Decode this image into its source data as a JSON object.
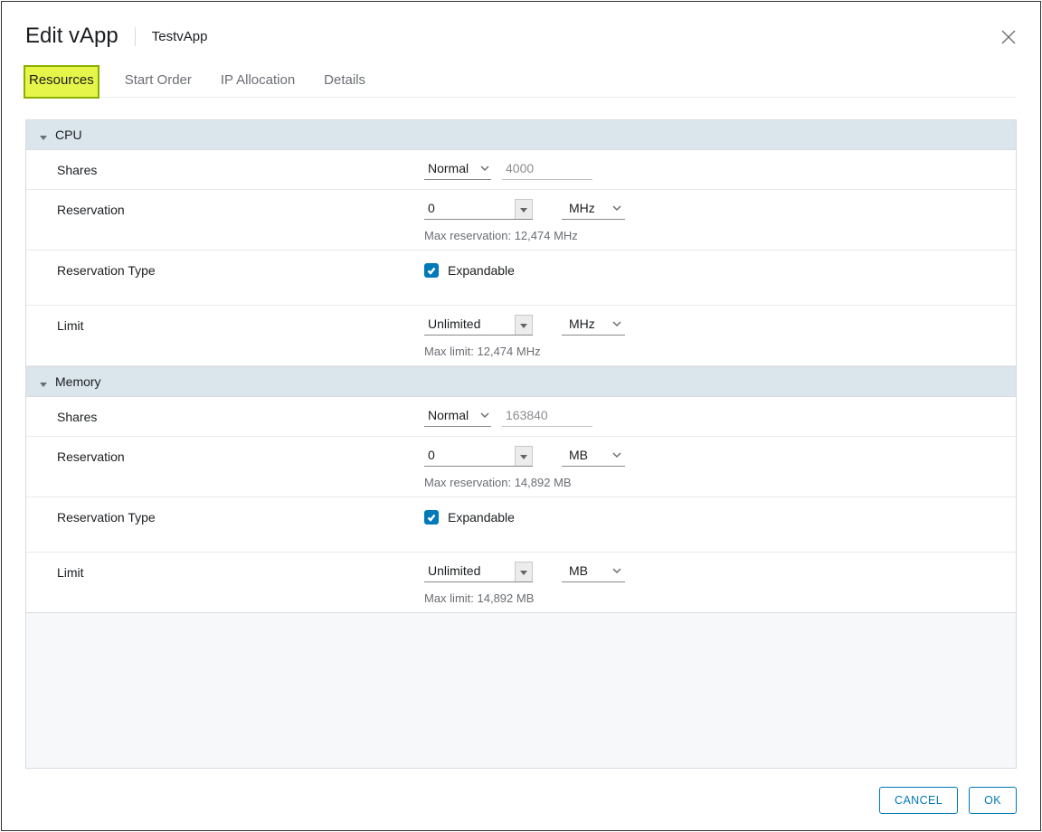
{
  "dialog": {
    "title": "Edit vApp",
    "subtitle": "TestvApp"
  },
  "tabs": [
    {
      "label": "Resources",
      "active": true
    },
    {
      "label": "Start Order",
      "active": false
    },
    {
      "label": "IP Allocation",
      "active": false
    },
    {
      "label": "Details",
      "active": false
    }
  ],
  "cpu": {
    "header": "CPU",
    "shares": {
      "label": "Shares",
      "level": "Normal",
      "value": "4000"
    },
    "reservation": {
      "label": "Reservation",
      "value": "0",
      "unit": "MHz",
      "hint": "Max reservation: 12,474 MHz"
    },
    "reservation_type": {
      "label": "Reservation Type",
      "checkbox_label": "Expandable",
      "checked": true
    },
    "limit": {
      "label": "Limit",
      "value": "Unlimited",
      "unit": "MHz",
      "hint": "Max limit: 12,474 MHz"
    }
  },
  "memory": {
    "header": "Memory",
    "shares": {
      "label": "Shares",
      "level": "Normal",
      "value": "163840"
    },
    "reservation": {
      "label": "Reservation",
      "value": "0",
      "unit": "MB",
      "hint": "Max reservation: 14,892 MB"
    },
    "reservation_type": {
      "label": "Reservation Type",
      "checkbox_label": "Expandable",
      "checked": true
    },
    "limit": {
      "label": "Limit",
      "value": "Unlimited",
      "unit": "MB",
      "hint": "Max limit: 14,892 MB"
    }
  },
  "footer": {
    "cancel": "CANCEL",
    "ok": "OK"
  }
}
